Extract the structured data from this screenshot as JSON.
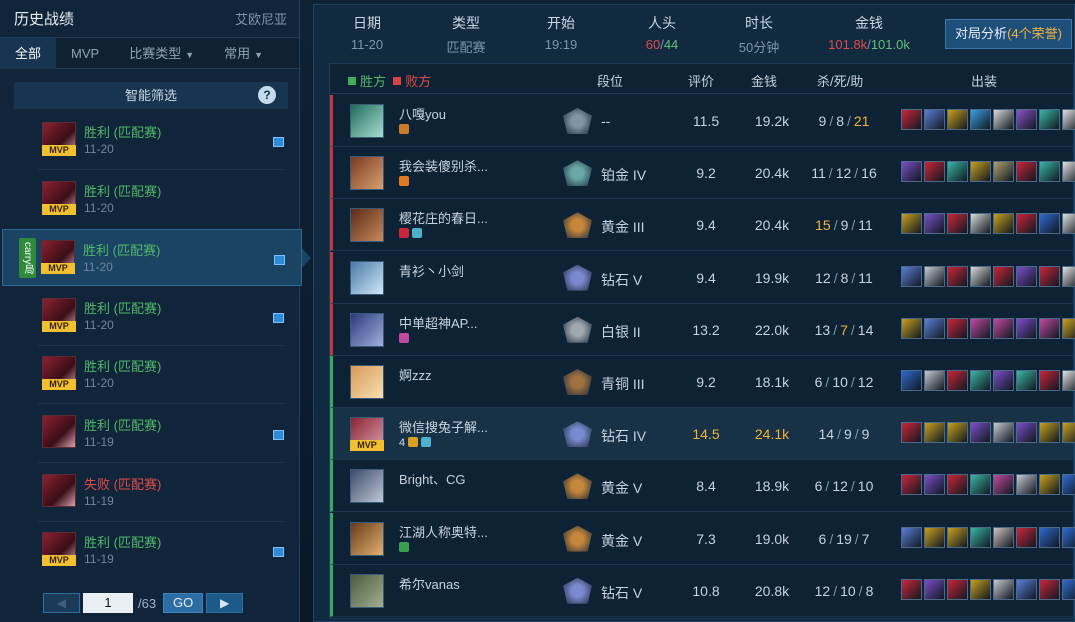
{
  "left": {
    "title": "历史战绩",
    "server": "艾欧尼亚",
    "tabs": [
      {
        "label": "全部",
        "active": true,
        "dropdown": false
      },
      {
        "label": "MVP",
        "active": false,
        "dropdown": false
      },
      {
        "label": "比赛类型",
        "active": false,
        "dropdown": true
      },
      {
        "label": "常用",
        "active": false,
        "dropdown": true
      }
    ],
    "smart_filter": "智能筛选",
    "smart_help": "?",
    "matches": [
      {
        "result": "胜利",
        "mode": "(匹配赛)",
        "date": "11-20",
        "mvp": true,
        "win": true,
        "selected": false,
        "carry": "",
        "icon": true
      },
      {
        "result": "胜利",
        "mode": "(匹配赛)",
        "date": "11-20",
        "mvp": true,
        "win": true,
        "selected": false,
        "carry": "",
        "icon": false
      },
      {
        "result": "胜利",
        "mode": "(匹配赛)",
        "date": "11-20",
        "mvp": true,
        "win": true,
        "selected": true,
        "carry": "carry局",
        "icon": true
      },
      {
        "result": "胜利",
        "mode": "(匹配赛)",
        "date": "11-20",
        "mvp": true,
        "win": true,
        "selected": false,
        "carry": "",
        "icon": true
      },
      {
        "result": "胜利",
        "mode": "(匹配赛)",
        "date": "11-20",
        "mvp": true,
        "win": true,
        "selected": false,
        "carry": "",
        "icon": false
      },
      {
        "result": "胜利",
        "mode": "(匹配赛)",
        "date": "11-19",
        "mvp": false,
        "win": true,
        "selected": false,
        "carry": "",
        "icon": true
      },
      {
        "result": "失败",
        "mode": "(匹配赛)",
        "date": "11-19",
        "mvp": false,
        "win": false,
        "selected": false,
        "carry": "",
        "icon": false
      },
      {
        "result": "胜利",
        "mode": "(匹配赛)",
        "date": "11-19",
        "mvp": true,
        "win": true,
        "selected": false,
        "carry": "",
        "icon": true
      }
    ],
    "pager": {
      "prev": "◀",
      "page": "1",
      "total": "/63",
      "go": "GO",
      "next": "▶"
    }
  },
  "summary": {
    "date_label": "日期",
    "date": "11-20",
    "type_label": "类型",
    "type": "匹配赛",
    "start_label": "开始",
    "start": "19:19",
    "kills_label": "人头",
    "kills_red": "60",
    "kills_sep": "/",
    "kills_green": "44",
    "duration_label": "时长",
    "duration": "50分钟",
    "gold_label": "金钱",
    "gold_red": "101.8k",
    "gold_sep": "/",
    "gold_green": "101.0k",
    "analysis_label": "对局分析",
    "analysis_honors": "(4个荣誉)"
  },
  "table": {
    "legend_win": "胜方",
    "legend_lose": "败方",
    "headers": {
      "rank": "段位",
      "score": "评价",
      "gold": "金钱",
      "kda": "杀/死/助",
      "items": "出装"
    },
    "players": [
      {
        "name": "八嘎you",
        "rank": "--",
        "score": "11.5",
        "gold": "19.2k",
        "k": "9",
        "d": "8",
        "a": "21",
        "hl_a": true,
        "team": "blue",
        "mvp": false,
        "me": false,
        "sub": "",
        "badges": [
          "#c97b2a"
        ],
        "champ": [
          "#1f6a5c",
          "#a8e0d0"
        ],
        "rank_color": "#7f95a8",
        "items": [
          "#c9263a",
          "#5b7fd6",
          "#c8a020",
          "#3a9fe0",
          "#d9d9d9",
          "#8c52c9",
          "#3bb6a6",
          "#e0e0e0"
        ]
      },
      {
        "name": "我会装傻别杀...",
        "rank": "铂金 IV",
        "score": "9.2",
        "gold": "20.4k",
        "k": "11",
        "d": "12",
        "a": "16",
        "team": "blue",
        "mvp": false,
        "me": false,
        "sub": "",
        "badges": [
          "#e07a20"
        ],
        "champ": [
          "#7a3a20",
          "#d8a070"
        ],
        "rank_color": "#6aa8a8",
        "items": [
          "#7b4fc9",
          "#c9263a",
          "#3bb6a6",
          "#c8a020",
          "#b0a070",
          "#c9263a",
          "#3bb6a6",
          "#e0e0e0"
        ]
      },
      {
        "name": "樱花庄的春日...",
        "rank": "黄金 III",
        "score": "9.4",
        "gold": "20.4k",
        "k": "15",
        "d": "9",
        "a": "11",
        "hl_k": true,
        "team": "blue",
        "mvp": false,
        "me": false,
        "sub": "",
        "badges": [
          "#c9263a",
          "#4fb0c9"
        ],
        "champ": [
          "#5a2a1a",
          "#c88a5a"
        ],
        "rank_color": "#c7873a",
        "items": [
          "#c8a020",
          "#7b4fc9",
          "#c9263a",
          "#d9d9d9",
          "#c8a020",
          "#c9263a",
          "#2d6ad0",
          "#e0e0e0"
        ]
      },
      {
        "name": "青衫丶小剑",
        "rank": "钻石 V",
        "score": "9.4",
        "gold": "19.9k",
        "k": "12",
        "d": "8",
        "a": "11",
        "team": "blue",
        "mvp": false,
        "me": false,
        "sub": "",
        "badges": [],
        "champ": [
          "#4a7aa8",
          "#d0e8f8"
        ],
        "rank_color": "#7a8ad0",
        "items": [
          "#5b7fd6",
          "#c8c8d0",
          "#c9263a",
          "#d9d9d9",
          "#c9263a",
          "#7b4fc9",
          "#c9263a",
          "#e0e0e0"
        ]
      },
      {
        "name": "中单超神AP...",
        "rank": "白银 II",
        "score": "13.2",
        "gold": "22.0k",
        "k": "13",
        "d": "7",
        "a": "14",
        "hl_d": true,
        "team": "blue",
        "mvp": false,
        "me": false,
        "sub": "",
        "badges": [
          "#c04aa0"
        ],
        "champ": [
          "#2a3a7a",
          "#a0b0e0"
        ],
        "rank_color": "#a0a8b0",
        "items": [
          "#c8a020",
          "#5b7fd6",
          "#c9263a",
          "#c04aa0",
          "#c04aa0",
          "#7b4fc9",
          "#c04aa0",
          "#c8a020"
        ]
      },
      {
        "name": "婀zzz",
        "rank": "青铜 III",
        "score": "9.2",
        "gold": "18.1k",
        "k": "6",
        "d": "10",
        "a": "12",
        "team": "red",
        "mvp": false,
        "me": false,
        "sub": "",
        "badges": [],
        "champ": [
          "#d89a5a",
          "#f8e0b0"
        ],
        "rank_color": "#a07040",
        "items": [
          "#2d6ad0",
          "#c8c8d0",
          "#c9263a",
          "#3bb6a6",
          "#7b4fc9",
          "#3bb6a6",
          "#c9263a",
          "#e0e0e0"
        ]
      },
      {
        "name": "微信搜兔子解...",
        "rank": "钻石 IV",
        "score": "14.5",
        "gold": "24.1k",
        "k": "14",
        "d": "9",
        "a": "9",
        "hl_score": true,
        "hl_gold": true,
        "team": "red",
        "mvp": true,
        "me": true,
        "sub": "4",
        "badges": [
          "#d9a020",
          "#4fb0c9"
        ],
        "champ": [
          "#8b2230",
          "#d9a0b0"
        ],
        "rank_color": "#7a8ad0",
        "items": [
          "#c9263a",
          "#c8a020",
          "#c8a020",
          "#7b4fc9",
          "#c8c8d0",
          "#7b4fc9",
          "#c8a020",
          "#c8a020"
        ]
      },
      {
        "name": "Bright、CG",
        "rank": "黄金 V",
        "score": "8.4",
        "gold": "18.9k",
        "k": "6",
        "d": "12",
        "a": "10",
        "team": "red",
        "mvp": false,
        "me": false,
        "sub": "",
        "badges": [],
        "champ": [
          "#3a4a6a",
          "#c0c8d8"
        ],
        "rank_color": "#c7873a",
        "items": [
          "#c9263a",
          "#7b4fc9",
          "#c9263a",
          "#3bb6a6",
          "#c04aa0",
          "#c8c8d0",
          "#c8a020",
          "#2d6ad0"
        ]
      },
      {
        "name": "江湖人称奥特...",
        "rank": "黄金 V",
        "score": "7.3",
        "gold": "19.0k",
        "k": "6",
        "d": "19",
        "a": "7",
        "team": "red",
        "mvp": false,
        "me": false,
        "sub": "",
        "badges": [
          "#3aa050"
        ],
        "champ": [
          "#6a3a1a",
          "#e0b070"
        ],
        "rank_color": "#c7873a",
        "items": [
          "#5b7fd6",
          "#c8a020",
          "#c8a020",
          "#3bb6a6",
          "#d0c0c0",
          "#c9263a",
          "#2d6ad0",
          "#2d6ad0"
        ]
      },
      {
        "name": "希尔vanas",
        "rank": "钻石 V",
        "score": "10.8",
        "gold": "20.8k",
        "k": "12",
        "d": "10",
        "a": "8",
        "team": "red",
        "mvp": false,
        "me": false,
        "sub": "",
        "badges": [],
        "champ": [
          "#4a5a3a",
          "#a0b090"
        ],
        "rank_color": "#7a8ad0",
        "items": [
          "#c9263a",
          "#7b4fc9",
          "#c9263a",
          "#c8a020",
          "#c8c8d0",
          "#5b7fd6",
          "#c9263a",
          "#2d6ad0"
        ]
      }
    ]
  }
}
